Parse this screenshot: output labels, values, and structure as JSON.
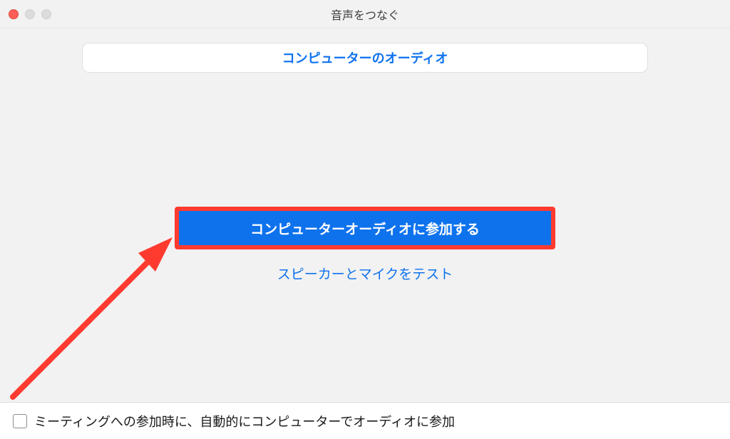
{
  "titlebar": {
    "title": "音声をつなぐ"
  },
  "tabs": {
    "computer_audio": "コンピューターのオーディオ"
  },
  "main": {
    "join_button": "コンピューターオーディオに参加する",
    "test_link": "スピーカーとマイクをテスト"
  },
  "footer": {
    "auto_join_label": "ミーティングへの参加時に、自動的にコンピューターでオーディオに参加"
  }
}
